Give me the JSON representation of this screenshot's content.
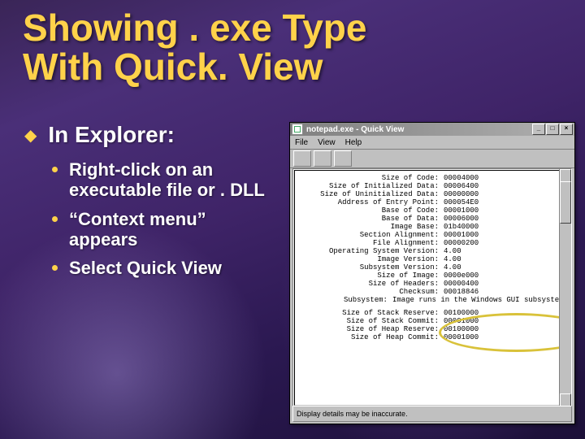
{
  "title_l1": "Showing . exe Type",
  "title_l2": "With Quick. View",
  "heading": "In Explorer:",
  "bullets": [
    "Right-click on an executable file or . DLL",
    "“Context menu” appears",
    "Select Quick View"
  ],
  "qv": {
    "title": "notepad.exe - Quick View",
    "menu": [
      "File",
      "View",
      "Help"
    ],
    "status": "Display details may be inaccurate.",
    "rows": [
      {
        "label": "Size of Code:",
        "value": "00004000"
      },
      {
        "label": "Size of Initialized Data:",
        "value": "00006400"
      },
      {
        "label": "Size of Uninitialized Data:",
        "value": "00000000"
      },
      {
        "label": "Address of Entry Point:",
        "value": "000054E0"
      },
      {
        "label": "Base of Code:",
        "value": "00001000"
      },
      {
        "label": "Base of Data:",
        "value": "00006000"
      },
      {
        "label": "Image Base:",
        "value": "01b40000"
      },
      {
        "label": "Section Alignment:",
        "value": "00001000"
      },
      {
        "label": "File Alignment:",
        "value": "00000200"
      },
      {
        "label": "Operating System Version:",
        "value": "4.00"
      },
      {
        "label": "Image Version:",
        "value": "4.00"
      },
      {
        "label": "Subsystem Version:",
        "value": "4.00"
      },
      {
        "label": "Size of Image:",
        "value": "0000e000"
      },
      {
        "label": "Size of Headers:",
        "value": "00000400"
      },
      {
        "label": "Checksum:",
        "value": "00018846"
      },
      {
        "label": "Subsystem:",
        "value": "Image runs in the Windows GUI subsystem."
      }
    ],
    "rows2": [
      {
        "label": "Size of Stack Reserve:",
        "value": "00100000"
      },
      {
        "label": "Size of Stack Commit:",
        "value": "00001000"
      },
      {
        "label": "Size of Heap Reserve:",
        "value": "00100000"
      },
      {
        "label": "Size of Heap Commit:",
        "value": "00001000"
      }
    ]
  }
}
